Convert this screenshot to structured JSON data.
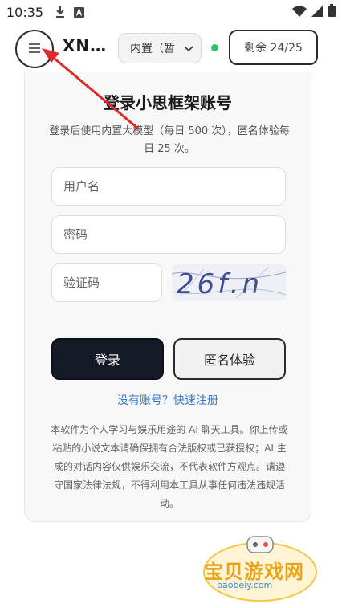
{
  "status_bar": {
    "time": "10:35",
    "icons": [
      "download-icon",
      "app-a-icon",
      "wifi-icon",
      "cellular-icon",
      "battery-icon"
    ]
  },
  "header": {
    "app_title": "XN…",
    "model_select_value": "内置（暂",
    "status_color": "#2ec46b",
    "quota_label": "剩余 24/25"
  },
  "login": {
    "title": "登录小思框架账号",
    "description": "登录后使用内置大模型（每日 500 次），匿名体验每日 25 次。",
    "username_placeholder": "用户名",
    "password_placeholder": "密码",
    "captcha_placeholder": "验证码",
    "captcha_text": "26f.n",
    "login_label": "登录",
    "guest_label": "匿名体验",
    "register_link": "没有账号？快速注册",
    "disclaimer": "本软件为个人学习与娱乐用途的 AI 聊天工具。你上传或粘贴的小说文本请确保拥有合法版权或已获授权；AI 生成的对话内容仅供娱乐交流，不代表软件方观点。请遵守国家法律法规，不得利用本工具从事任何违法违规活动。"
  },
  "watermark": {
    "text": "宝贝游戏网",
    "domain": "baobeiy.com"
  },
  "colors": {
    "accent_dark": "#141a26",
    "link": "#3a78c9",
    "arrow": "#e02828"
  }
}
